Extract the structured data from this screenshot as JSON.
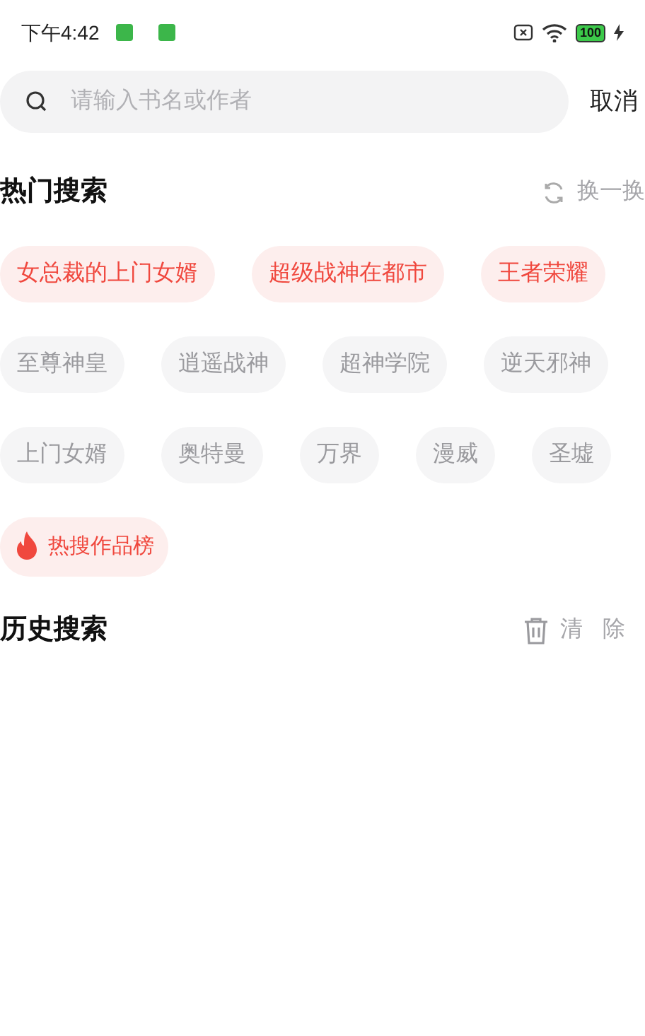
{
  "status_bar": {
    "time": "下午4:42",
    "battery": "100"
  },
  "search": {
    "placeholder": "请输入书名或作者",
    "cancel": "取消"
  },
  "hot": {
    "title": "热门搜索",
    "refresh": "换一换",
    "tags": [
      {
        "label": "女总裁的上门女婿",
        "hot": true
      },
      {
        "label": "超级战神在都市",
        "hot": true
      },
      {
        "label": "王者荣耀",
        "hot": true
      },
      {
        "label": "至尊神皇",
        "hot": false
      },
      {
        "label": "逍遥战神",
        "hot": false
      },
      {
        "label": "超神学院",
        "hot": false
      },
      {
        "label": "逆天邪神",
        "hot": false
      },
      {
        "label": "上门女婿",
        "hot": false
      },
      {
        "label": "奥特曼",
        "hot": false
      },
      {
        "label": "万界",
        "hot": false
      },
      {
        "label": "漫威",
        "hot": false
      },
      {
        "label": "圣墟",
        "hot": false
      }
    ],
    "ranking": "热搜作品榜"
  },
  "history": {
    "title": "历史搜索",
    "clear": "清除"
  }
}
